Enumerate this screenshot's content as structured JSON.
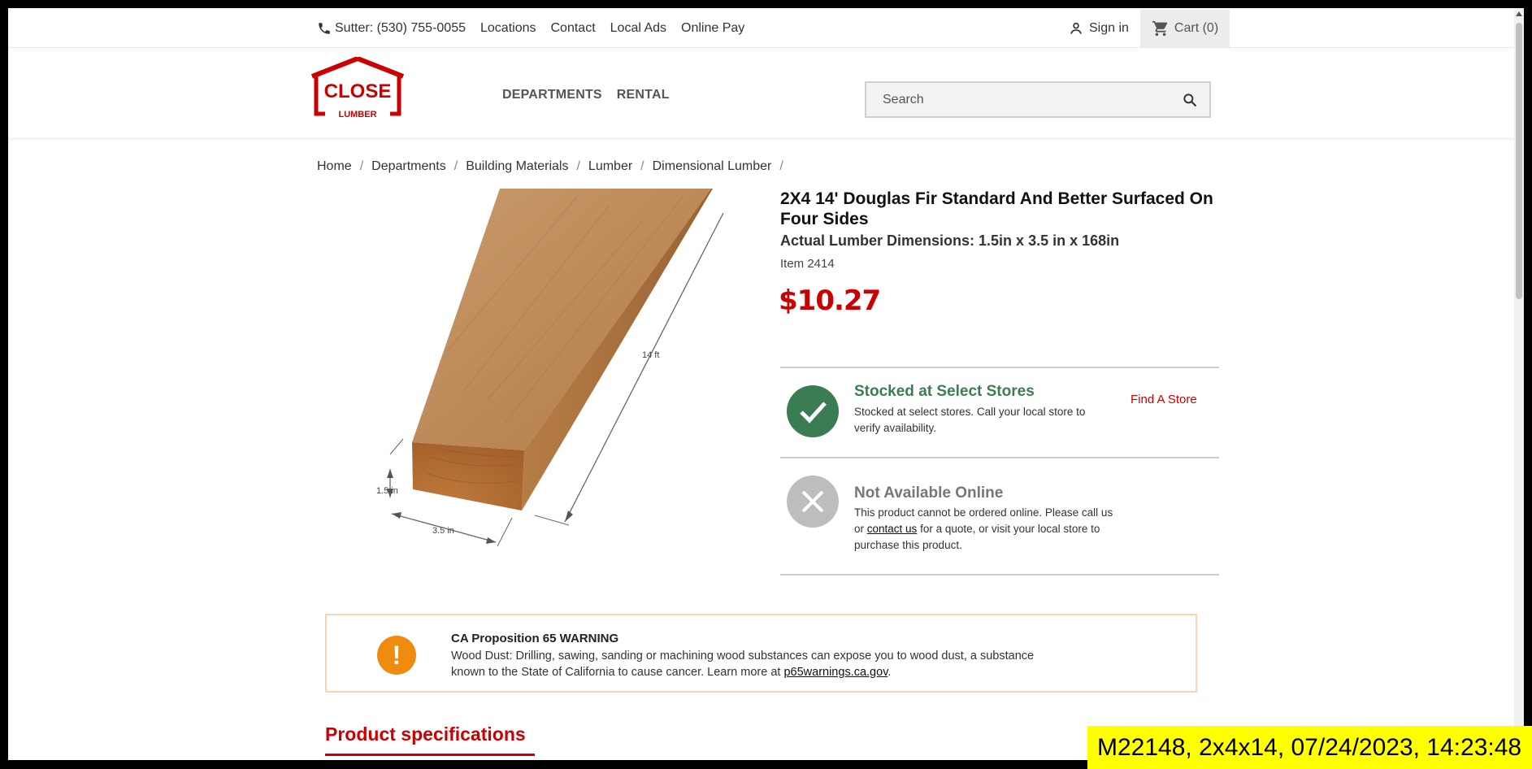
{
  "topbar": {
    "phone": "Sutter: (530) 755-0055",
    "links": [
      "Locations",
      "Contact",
      "Local Ads",
      "Online Pay"
    ],
    "signin": "Sign in",
    "cart": "Cart (0)"
  },
  "logo": {
    "line1": "CLOSE",
    "line2": "LUMBER"
  },
  "nav": [
    "DEPARTMENTS",
    "RENTAL"
  ],
  "search": {
    "placeholder": "Search"
  },
  "breadcrumb": [
    "Home",
    "Departments",
    "Building Materials",
    "Lumber",
    "Dimensional Lumber"
  ],
  "image_labels": {
    "length": "14 ft",
    "height": "1.5 in",
    "width": "3.5 in"
  },
  "product": {
    "title": "2X4 14' Douglas Fir Standard And Better Surfaced On Four Sides",
    "dimensions": "Actual Lumber Dimensions: 1.5in x 3.5 in x 168in",
    "item": "Item 2414",
    "price": "$10.27"
  },
  "availability": {
    "stocked": {
      "head": "Stocked at Select Stores",
      "desc": "Stocked at select stores. Call your local store to verify availability.",
      "link": "Find A Store"
    },
    "online": {
      "head": "Not Available Online",
      "desc_pre": "This product cannot be ordered online. Please call us or ",
      "desc_link": "contact us",
      "desc_post": " for a quote, or visit your local store to purchase this product."
    }
  },
  "warning": {
    "title": "CA Proposition 65 WARNING",
    "text": "Wood Dust: Drilling, sawing, sanding or machining wood substances can expose you to wood dust, a substance known to the State of California to cause cancer. Learn more at ",
    "link": "p65warnings.ca.gov",
    "end": "."
  },
  "specs_heading": "Product specifications",
  "stamp": "M22148, 2x4x14, 07/24/2023, 14:23:48",
  "colors": {
    "brand_red": "#cc0000",
    "stock_green": "#3a7d53",
    "warn_orange": "#ef8c0e"
  }
}
